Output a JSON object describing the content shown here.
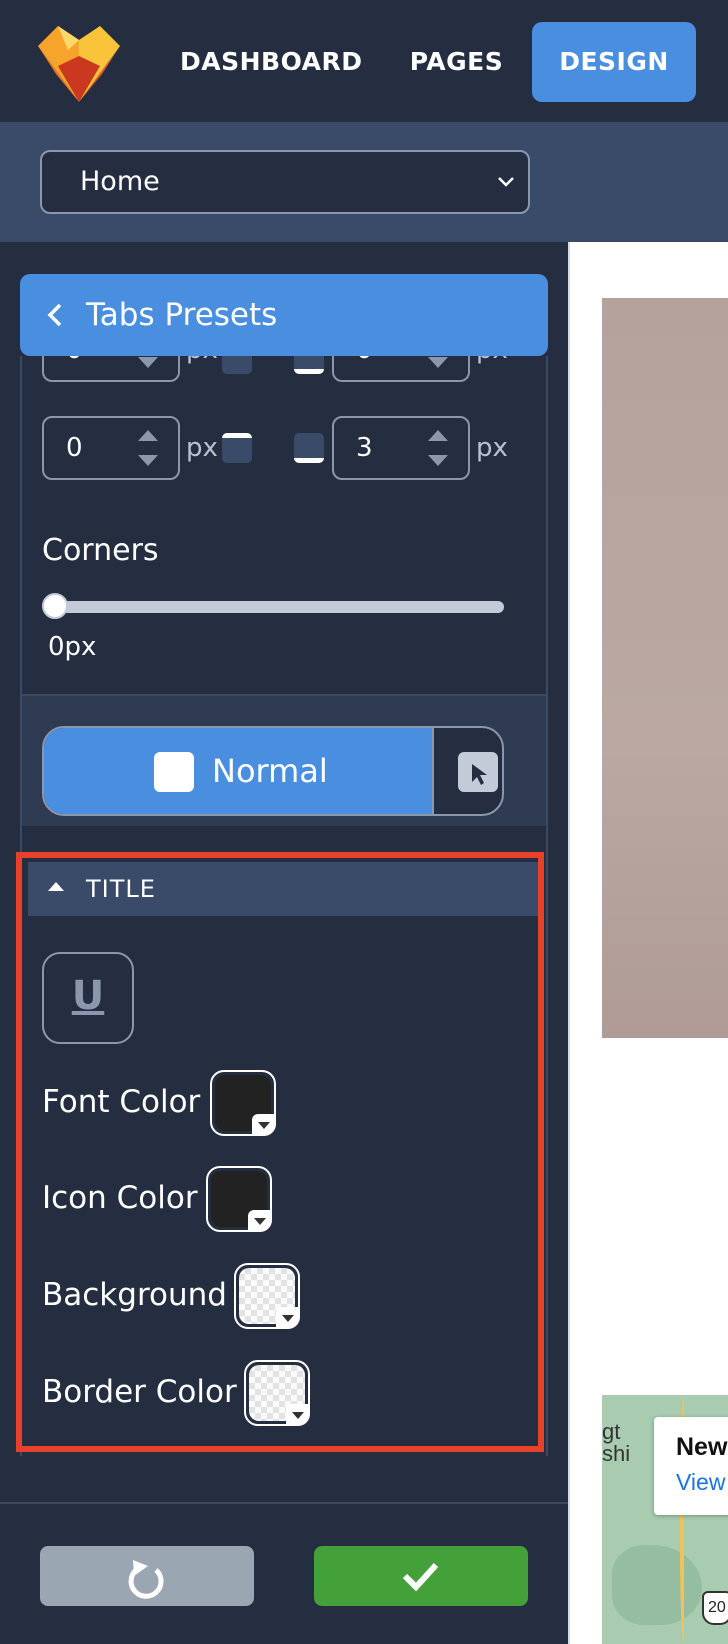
{
  "nav": {
    "logo": "heart-logo",
    "items": [
      {
        "label": "DASHBOARD",
        "active": false
      },
      {
        "label": "PAGES",
        "active": false
      },
      {
        "label": "DESIGN",
        "active": true
      }
    ]
  },
  "page_select": {
    "value": "Home"
  },
  "presets_header": {
    "label": "Tabs Presets"
  },
  "padding": {
    "top_left": {
      "value": "0",
      "unit": "px"
    },
    "top_right": {
      "value": "0",
      "unit": "px"
    },
    "bottom_left": {
      "value": "0",
      "unit": "px"
    },
    "bottom_right": {
      "value": "3",
      "unit": "px"
    }
  },
  "corners": {
    "label": "Corners",
    "value": "0px",
    "level": 0
  },
  "state_toggle": {
    "normal_label": "Normal"
  },
  "title_section": {
    "header": "TITLE",
    "underline_glyph": "U",
    "rows": [
      {
        "label": "Font Color",
        "swatch": "#222222"
      },
      {
        "label": "Icon Color",
        "swatch": "#222222"
      },
      {
        "label": "Background",
        "swatch": "transparent"
      },
      {
        "label": "Border Color",
        "swatch": "transparent"
      }
    ]
  },
  "map": {
    "side_text": "gt\nshi",
    "card_title": "New Yo",
    "card_link": "View lar",
    "badge": "20"
  },
  "colors": {
    "nav_bg": "#252e40",
    "accent": "#4a8ee0",
    "confirm": "#44a038",
    "reset": "#9ba6b3",
    "highlight": "#e8412a"
  }
}
